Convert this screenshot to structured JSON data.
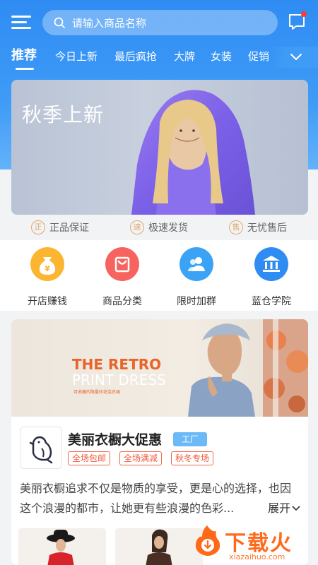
{
  "header": {
    "search_placeholder": "请输入商品名称",
    "menu_icon": "hamburger-menu-icon",
    "message_icon": "message-icon",
    "notification_dot_color": "#ff3b30"
  },
  "tabs": {
    "items": [
      "推荐",
      "今日上新",
      "最后疯抢",
      "大牌",
      "女装",
      "促销"
    ],
    "active_index": 0,
    "more_icon": "chevron-down-icon"
  },
  "banner": {
    "title": "秋季上新",
    "slide_count": 4,
    "active_slide": 0
  },
  "guarantees": [
    {
      "icon_char": "正",
      "label": "正品保证"
    },
    {
      "icon_char": "速",
      "label": "极速发货"
    },
    {
      "icon_char": "售",
      "label": "无忧售后"
    }
  ],
  "features": [
    {
      "label": "开店赚钱",
      "icon": "money-bag-icon",
      "color": "#fbb531"
    },
    {
      "label": "商品分类",
      "icon": "shopping-bag-icon",
      "color": "#f7645f"
    },
    {
      "label": "限时加群",
      "icon": "group-users-icon",
      "color": "#3aa3f5"
    },
    {
      "label": "蓝仓学院",
      "icon": "academy-building-icon",
      "color": "#2f8cf3"
    }
  ],
  "shop_card": {
    "banner_line1": "THE RETRO",
    "banner_line2": "PRINT DRESS",
    "banner_line3": "可收藏的限量印花连衣裙",
    "name": "美丽衣橱大促惠",
    "badge": "工厂",
    "tags": [
      "全场包邮",
      "全场满减",
      "秋冬专场"
    ],
    "description": "美丽衣橱追求不仅是物质的享受，更是心的选择，也因这个浪漫的都市，让她更有些浪漫的色彩...",
    "expand_label": "展开"
  },
  "watermark": {
    "text": "下载火",
    "url": "xiazaihuo.com"
  },
  "colors": {
    "brand_blue": "#2f8cf3",
    "guarantee_gold": "#e0a86e",
    "tag_red": "#ef5a3c",
    "badge_blue": "#6cb9f7"
  }
}
